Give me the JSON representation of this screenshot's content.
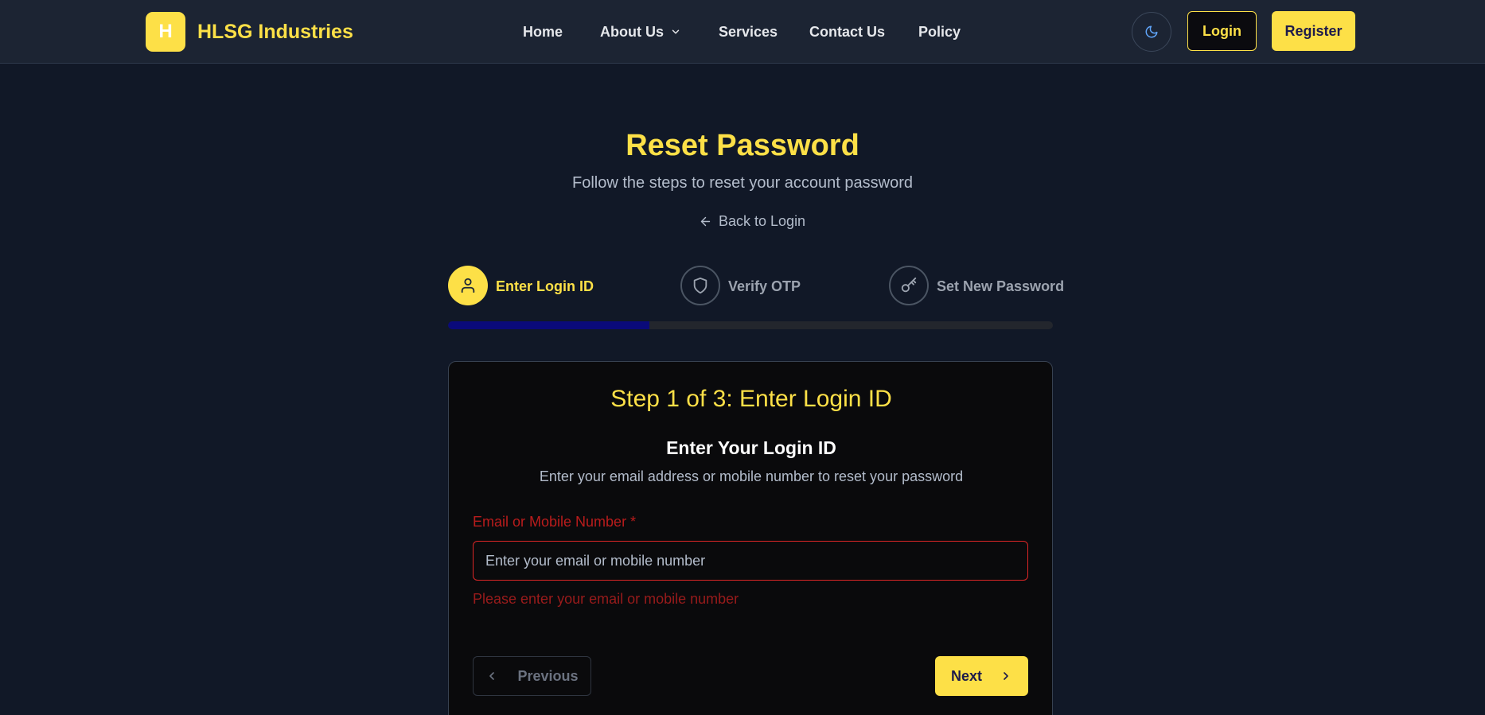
{
  "header": {
    "logo_letter": "H",
    "brand": "HLSG Industries",
    "nav": [
      {
        "label": "Home",
        "has_dropdown": false
      },
      {
        "label": "About Us",
        "has_dropdown": true
      },
      {
        "label": "Services",
        "has_dropdown": false
      },
      {
        "label": "Contact Us",
        "has_dropdown": false
      },
      {
        "label": "Policy",
        "has_dropdown": false
      }
    ],
    "theme_icon": "moon-icon",
    "login_label": "Login",
    "register_label": "Register"
  },
  "page": {
    "title": "Reset Password",
    "subtitle": "Follow the steps to reset your account password",
    "back_link": "Back to Login"
  },
  "steps": [
    {
      "label": "Enter Login ID",
      "icon": "user-icon",
      "state": "active"
    },
    {
      "label": "Verify OTP",
      "icon": "shield-icon",
      "state": "inactive"
    },
    {
      "label": "Set New Password",
      "icon": "key-icon",
      "state": "inactive"
    }
  ],
  "progress": {
    "current_step": 1,
    "total_steps": 3,
    "fraction": 0.333
  },
  "card": {
    "title": "Step 1 of 3: Enter Login ID",
    "heading": "Enter Your Login ID",
    "description": "Enter your email address or mobile number to reset your password",
    "field": {
      "label": "Email or Mobile Number *",
      "value": "",
      "placeholder": "Enter your email or mobile number",
      "error": "Please enter your email or mobile number"
    },
    "previous_label": "Previous",
    "next_label": "Next"
  },
  "colors": {
    "accent": "#fde047",
    "background": "#111827",
    "header": "#1c2433",
    "error": "#dc2626",
    "progress_fill": "#0a0a7a"
  }
}
